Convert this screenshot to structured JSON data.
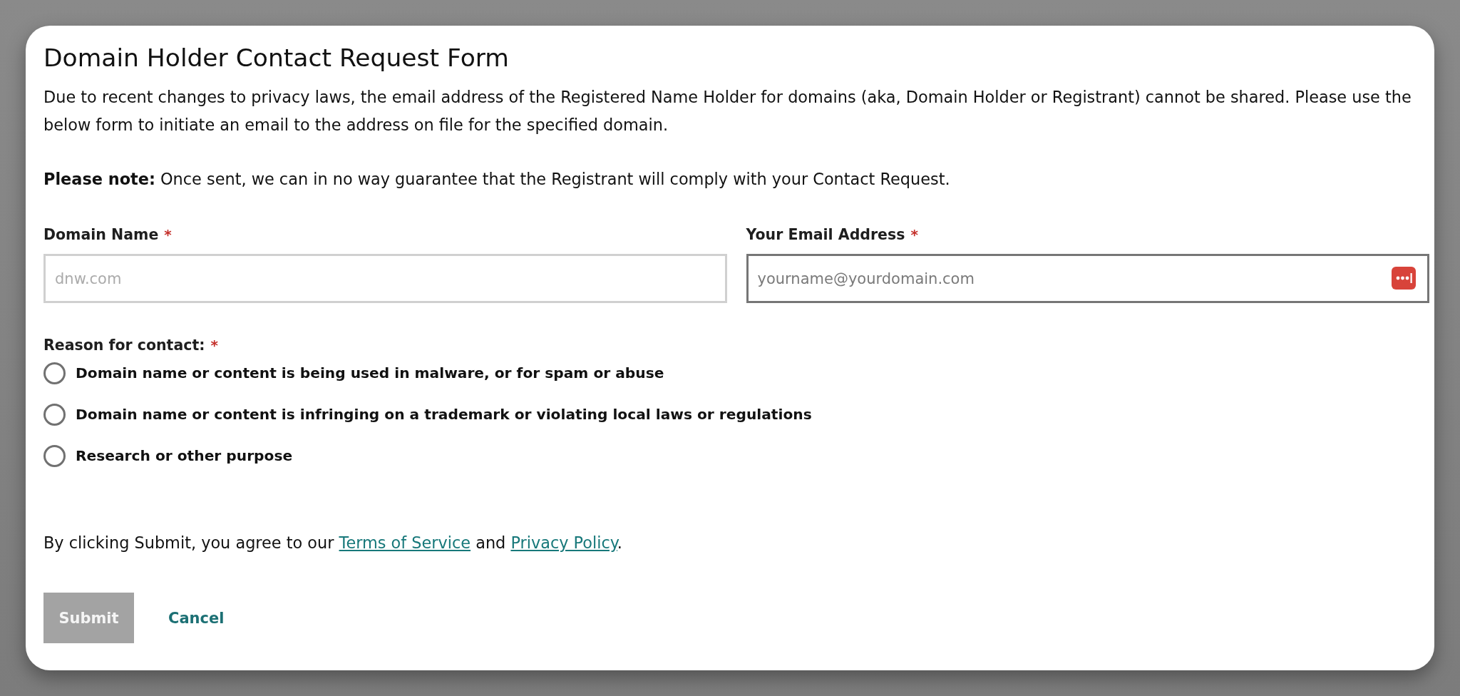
{
  "form": {
    "title": "Domain Holder Contact Request Form",
    "intro": "Due to recent changes to privacy laws, the email address of the Registered Name Holder for domains (aka, Domain Holder or Registrant) cannot be shared. Please use the below form to initiate an email to the address on file for the specified domain.",
    "note": "**Please note:** Once sent, we can in no way guarantee that the Registrant will comply with your Contact Request.",
    "fields": [
      {
        "label": "Domain Name",
        "required_mark": "*",
        "placeholder": "dnw.com",
        "focused": false,
        "autofill_icon": false
      },
      {
        "label": "Your Email Address",
        "required_mark": "*",
        "placeholder": "yourname@yourdomain.com",
        "focused": true,
        "autofill_icon": true
      }
    ],
    "reason": {
      "label": "Reason for contact:",
      "required_mark": "*",
      "options": [
        {
          "label": "Domain name or content is being used in malware, or for spam or abuse",
          "selected": false
        },
        {
          "label": "Domain name or content is infringing on a trademark or violating local laws or regulations",
          "selected": false
        },
        {
          "label": "Research or other purpose",
          "selected": false
        }
      ]
    },
    "consent": [
      {
        "kind": "text",
        "text": "By clicking Submit, you agree to our "
      },
      {
        "kind": "link",
        "text": "Terms of Service"
      },
      {
        "kind": "text",
        "text": " and "
      },
      {
        "kind": "link",
        "text": "Privacy Policy"
      },
      {
        "kind": "text",
        "text": "."
      }
    ],
    "buttons": [
      {
        "kind": "primary",
        "label": "Submit",
        "disabled": true
      },
      {
        "kind": "link",
        "label": "Cancel"
      }
    ]
  }
}
